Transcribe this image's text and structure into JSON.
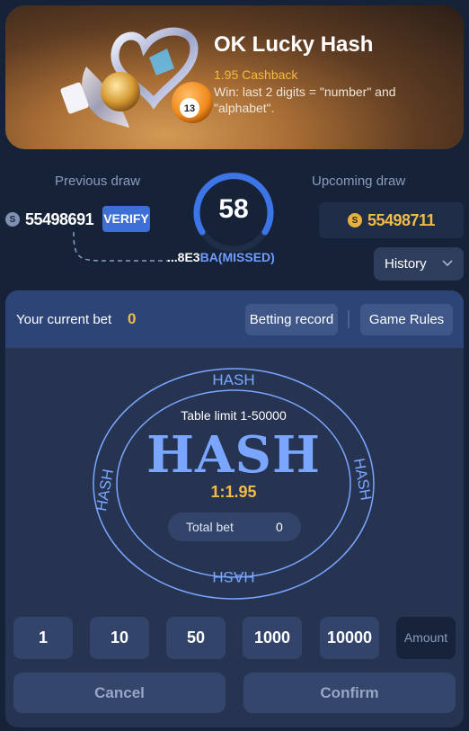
{
  "banner": {
    "title": "OK Lucky Hash",
    "cashback": "1.95 Cashback",
    "description": "Win: last 2 digits = \"number\" and \"alphabet\".",
    "ball_number": "13"
  },
  "draw": {
    "previous_label": "Previous draw",
    "previous_number": "55498691",
    "verify_label": "VERIFY",
    "hash_prefix": "...8E3",
    "hash_suffix": "BA",
    "missed_label": "(MISSED)",
    "timer": "58",
    "upcoming_label": "Upcoming draw",
    "upcoming_number": "55498711",
    "coin_glyph": "S"
  },
  "history": {
    "label": "History"
  },
  "bet_panel": {
    "current_bet_label": "Your current bet",
    "current_bet_value": "0",
    "betting_record_label": "Betting record",
    "game_rules_label": "Game Rules",
    "table_ring_text": "HASH",
    "table_limit": "Table limit 1-50000",
    "table_name": "HASH",
    "odds": "1:1.95",
    "total_bet_label": "Total bet",
    "total_bet_value": "0"
  },
  "chips": [
    "1",
    "10",
    "50",
    "1000",
    "10000"
  ],
  "amount_label": "Amount",
  "actions": {
    "cancel": "Cancel",
    "confirm": "Confirm"
  },
  "colors": {
    "background": "#162238",
    "accent_blue": "#3d6fd6",
    "gold": "#f1bb45",
    "hash_blue": "#7aa6ff"
  }
}
